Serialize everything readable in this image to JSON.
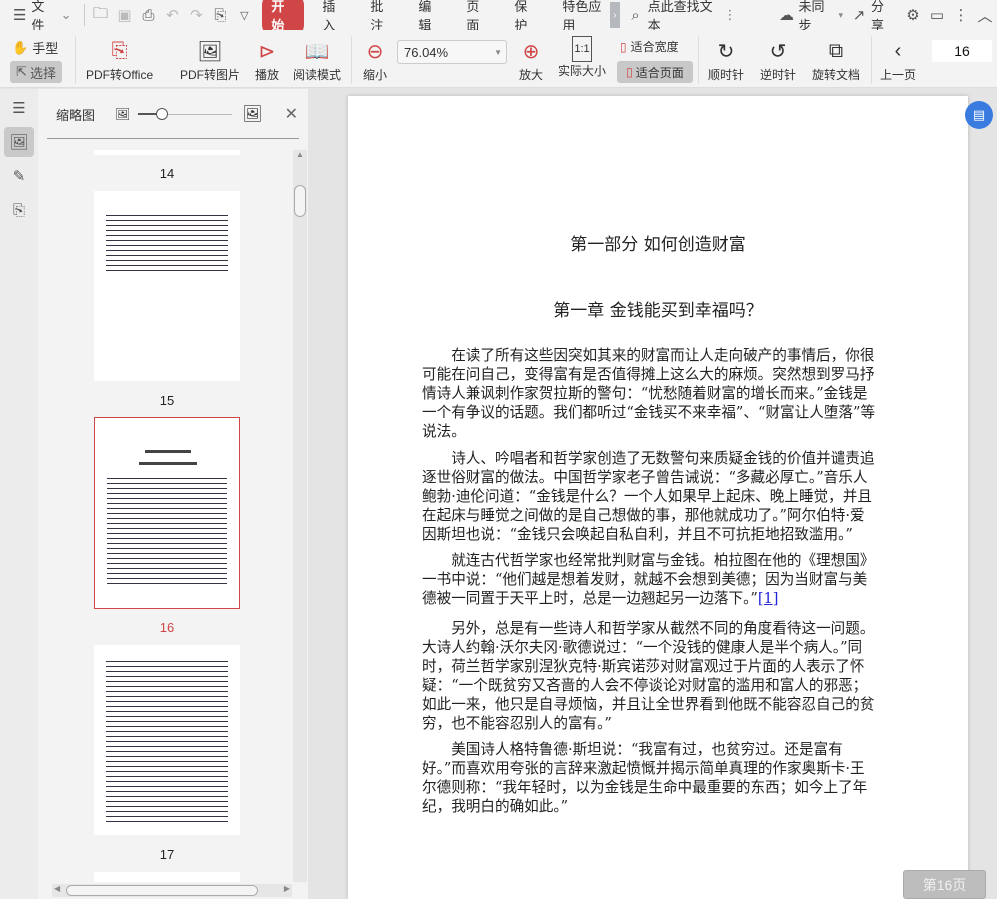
{
  "menubar": {
    "file": "文件",
    "tabs": [
      "开始",
      "插入",
      "批注",
      "编辑",
      "页面",
      "保护",
      "特色应用"
    ],
    "search_placeholder": "点此查找文本",
    "sync": "未同步",
    "share": "分享"
  },
  "toolbar": {
    "hand": "手型",
    "select": "选择",
    "pdf_office": "PDF转Office",
    "pdf_image": "PDF转图片",
    "play": "播放",
    "read_mode": "阅读模式",
    "zoom_out": "缩小",
    "zoom_value": "76.04%",
    "zoom_in": "放大",
    "actual_size": "实际大小",
    "fit_width": "适合宽度",
    "fit_page": "适合页面",
    "rotate_cw": "顺时针",
    "rotate_ccw": "逆时针",
    "rotate_doc": "旋转文档",
    "prev_page": "上一页",
    "page_number": "16"
  },
  "thumbnails": {
    "title": "缩略图",
    "pages": [
      "14",
      "15",
      "16",
      "17"
    ],
    "current": "16",
    "slider_fraction": 0.25
  },
  "document": {
    "part_title": "第一部分 如何创造财富",
    "chapter_title": "第一章 金钱能买到幸福吗？",
    "paragraphs": [
      [
        "　　在读了所有这些因突如其来的财富而让人走向破产的事情后，你很",
        "可能在问自己，变得富有是否值得摊上这么大的麻烦。突然想到罗马抒",
        "情诗人兼讽刺作家贺拉斯的警句：“忧愁随着财富的增长而来。”金钱是",
        "一个有争议的话题。我们都听过“金钱买不来幸福”、“财富让人堕落”等",
        "说法。"
      ],
      [
        "　　诗人、吟唱者和哲学家创造了无数警句来质疑金钱的价值并谴责追",
        "逐世俗财富的做法。中国哲学家老子曾告诫说：“多藏必厚亡。”音乐人",
        "鲍勃·迪伦问道：“金钱是什么？一个人如果早上起床、晚上睡觉，并且",
        "在起床与睡觉之间做的是自己想做的事，那他就成功了。”阿尔伯特·爱",
        "因斯坦也说：“金钱只会唤起自私自利，并且不可抗拒地招致滥用。”"
      ],
      [
        "　　就连古代哲学家也经常批判财富与金钱。柏拉图在他的《理想国》",
        "一书中说：“他们越是想着发财，就越不会想到美德；因为当财富与美",
        "德被一同置于天平上时，总是一边翘起另一边落下。”"
      ],
      [
        "　　另外，总是有一些诗人和哲学家从截然不同的角度看待这一问题。",
        "大诗人约翰·沃尔夫冈·歌德说过：“一个没钱的健康人是半个病人。”同",
        "时，荷兰哲学家别涅狄克特·斯宾诺莎对财富观过于片面的人表示了怀",
        "疑：“一个既贫穷又吝啬的人会不停谈论对财富的滥用和富人的邪恶；",
        "如此一来，他只是自寻烦恼，并且让全世界看到他既不能容忍自己的贫",
        "穷，也不能容忍别人的富有。”"
      ],
      [
        "　　美国诗人格特鲁德·斯坦说：“我富有过，也贫穷过。还是富有",
        "好。”而喜欢用夸张的言辞来激起愤慨并揭示简单真理的作家奥斯卡·王",
        "尔德则称：“我年轻时，以为金钱是生命中最重要的东西；如今上了年",
        "纪，我明白的确如此。”"
      ]
    ],
    "footnote": "[1]"
  },
  "status": {
    "page_badge": "第16页"
  },
  "colors": {
    "accent": "#d04545",
    "link": "#2323d8"
  }
}
